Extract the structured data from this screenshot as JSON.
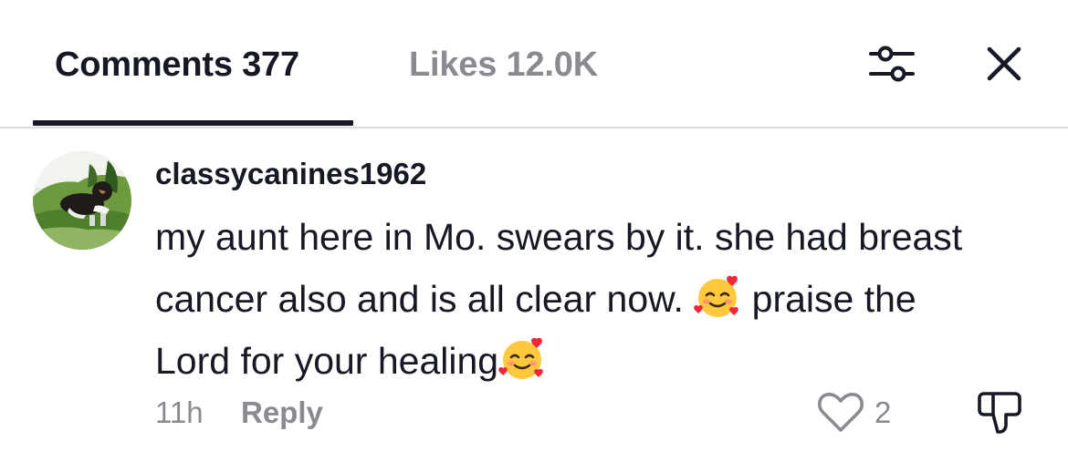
{
  "tabs": {
    "comments_label": "Comments 377",
    "likes_label": "Likes 12.0K"
  },
  "header_icons": {
    "filter": "sliders-icon",
    "close": "close-icon"
  },
  "comment": {
    "username": "classycanines1962",
    "text_part1": "my aunt here in Mo. swears by it. she had breast cancer also and is all clear now. ",
    "text_part2": " praise the Lord for your healing",
    "emoji": "smiling-face-with-hearts-emoji",
    "time": "11h",
    "reply_label": "Reply",
    "like_count": "2"
  },
  "colors": {
    "primary_text": "#161823",
    "secondary_text": "#8a8b91",
    "divider": "#dcdcdc"
  }
}
